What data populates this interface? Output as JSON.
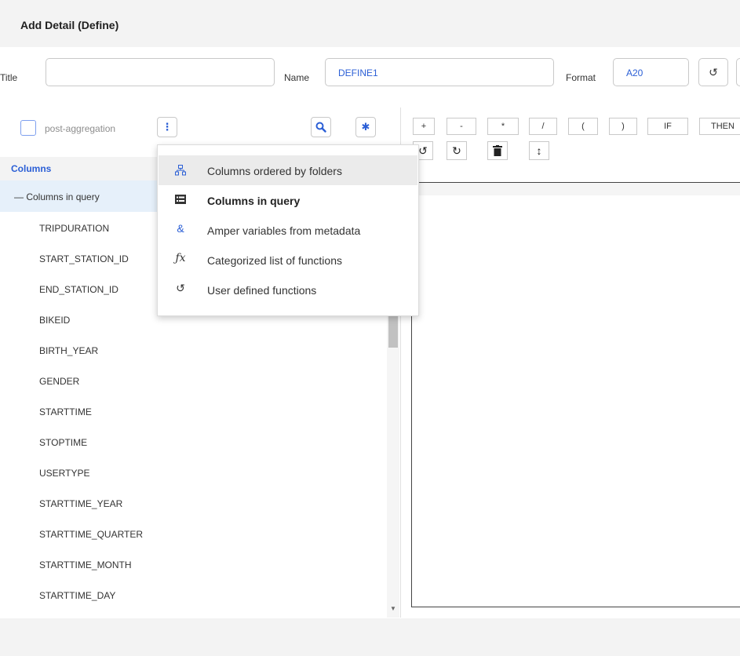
{
  "dialog": {
    "title": "Add Detail (Define)"
  },
  "form": {
    "title_label": "Title",
    "title_value": "",
    "name_label": "Name",
    "name_value": "DEFINE1",
    "format_label": "Format",
    "format_value": "A20"
  },
  "left_toolbar": {
    "post_aggregation_label": "post-aggregation",
    "more_icon": "kebab-icon",
    "search_icon": "search-icon",
    "settings_icon": "gear-icon"
  },
  "operators": [
    "+",
    "-",
    "*",
    "/",
    "(",
    ")",
    "IF",
    "THEN"
  ],
  "edit_tools": [
    "undo-icon",
    "redo-icon",
    "trash-icon",
    "resize-icon"
  ],
  "tree": {
    "header": "Columns",
    "group_label": "— Columns in query",
    "items": [
      "TRIPDURATION",
      "START_STATION_ID",
      "END_STATION_ID",
      "BIKEID",
      "BIRTH_YEAR",
      "GENDER",
      "STARTTIME",
      "STOPTIME",
      "USERTYPE",
      "STARTTIME_YEAR",
      "STARTTIME_QUARTER",
      "STARTTIME_MONTH",
      "STARTTIME_DAY"
    ]
  },
  "menu": {
    "items": [
      {
        "label": "Columns ordered by folders",
        "icon": "folder-tree-icon"
      },
      {
        "label": "Columns in query",
        "icon": "list-icon"
      },
      {
        "label": "Amper variables from metadata",
        "icon": "ampersand-icon"
      },
      {
        "label": "Categorized list of functions",
        "icon": "function-icon"
      },
      {
        "label": "User defined functions",
        "icon": "user-function-icon"
      }
    ]
  },
  "colors": {
    "accent": "#2b5fd6",
    "header_bg": "#f3f3f3",
    "selected_row": "#e6f0fa"
  }
}
